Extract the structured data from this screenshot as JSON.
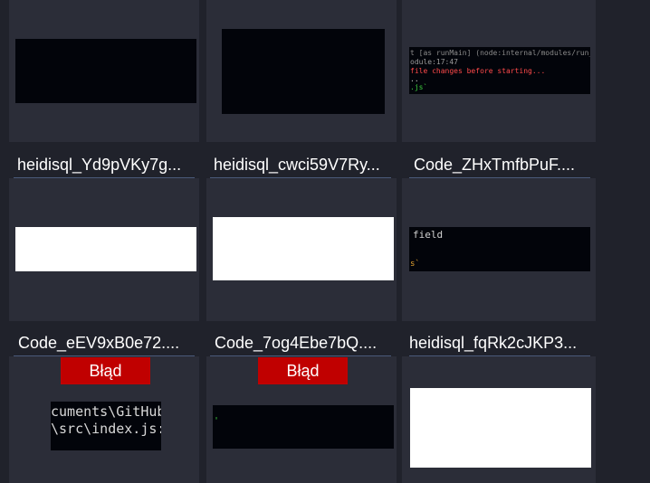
{
  "tiles": [
    {
      "label": "heidisql_Yd9pVKy7g..."
    },
    {
      "label": "heidisql_cwci59V7Ry..."
    },
    {
      "label": "Code_ZHxTmfbPuF....",
      "lines": [
        "t [as runMain] (node:internal/modules/run_m",
        "odule:17:47",
        "file changes before starting...",
        "..",
        ".js`"
      ]
    },
    {
      "label": "Code_eEV9xB0e72...."
    },
    {
      "label": "Code_7og4Ebe7bQ...."
    },
    {
      "label": "heidisql_fqRk2cJKP3...",
      "lines": [
        "field",
        "",
        "s`"
      ]
    },
    {
      "badge": "Błąd",
      "lines": [
        "cuments\\GitHub",
        "\\src\\index.js:"
      ]
    },
    {
      "badge": "Błąd",
      "lines": [
        "'"
      ]
    },
    {}
  ],
  "colors": {
    "background": "#20222b",
    "tile": "#2b2d38",
    "error_badge": "#c00000",
    "terminal": "#02040a"
  }
}
